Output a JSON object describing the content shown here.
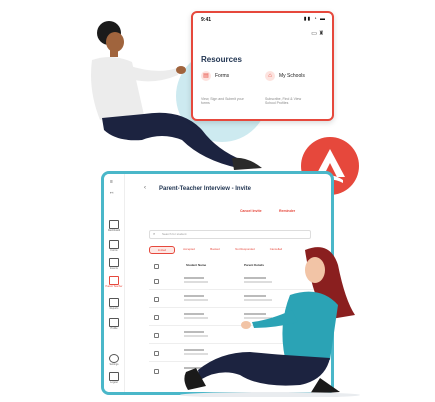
{
  "phone": {
    "time": "9:41",
    "status_icons": "▮▮ ◔ ▬",
    "toolbar_icons": "▭  ♜",
    "resources_title": "Resources",
    "items": [
      {
        "label": "Forms",
        "desc": "View, Sign and Submit your forms",
        "icon": "document-icon"
      },
      {
        "label": "My Schools",
        "desc": "Subscribe, Find & View School Profiles",
        "icon": "school-icon"
      }
    ]
  },
  "tablet": {
    "page_title": "Parent-Teacher Interview - Invite",
    "actions": [
      "Cancel Invite",
      "Reminder"
    ],
    "search_placeholder": "Search for student",
    "tabs": [
      "Invited",
      "Accepted",
      "Booked",
      "Not Responded",
      "Cancelled"
    ],
    "columns": [
      "Student Name",
      "Parent Details"
    ],
    "sidebar": [
      {
        "label": "Dashboard",
        "icon": "dashboard-icon"
      },
      {
        "label": "Forms",
        "icon": "form-icon"
      },
      {
        "label": "Events",
        "icon": "calendar-icon"
      },
      {
        "label": "Parent Teacher",
        "icon": "people-icon"
      },
      {
        "label": "Reports",
        "icon": "report-icon"
      },
      {
        "label": "Profile",
        "icon": "person-icon"
      },
      {
        "label": "Settings",
        "icon": "settings-icon"
      },
      {
        "label": "Logout",
        "icon": "logout-icon"
      }
    ]
  },
  "colors": {
    "accent": "#e6483c",
    "teal": "#4ab7c9",
    "navy": "#1f3350"
  }
}
